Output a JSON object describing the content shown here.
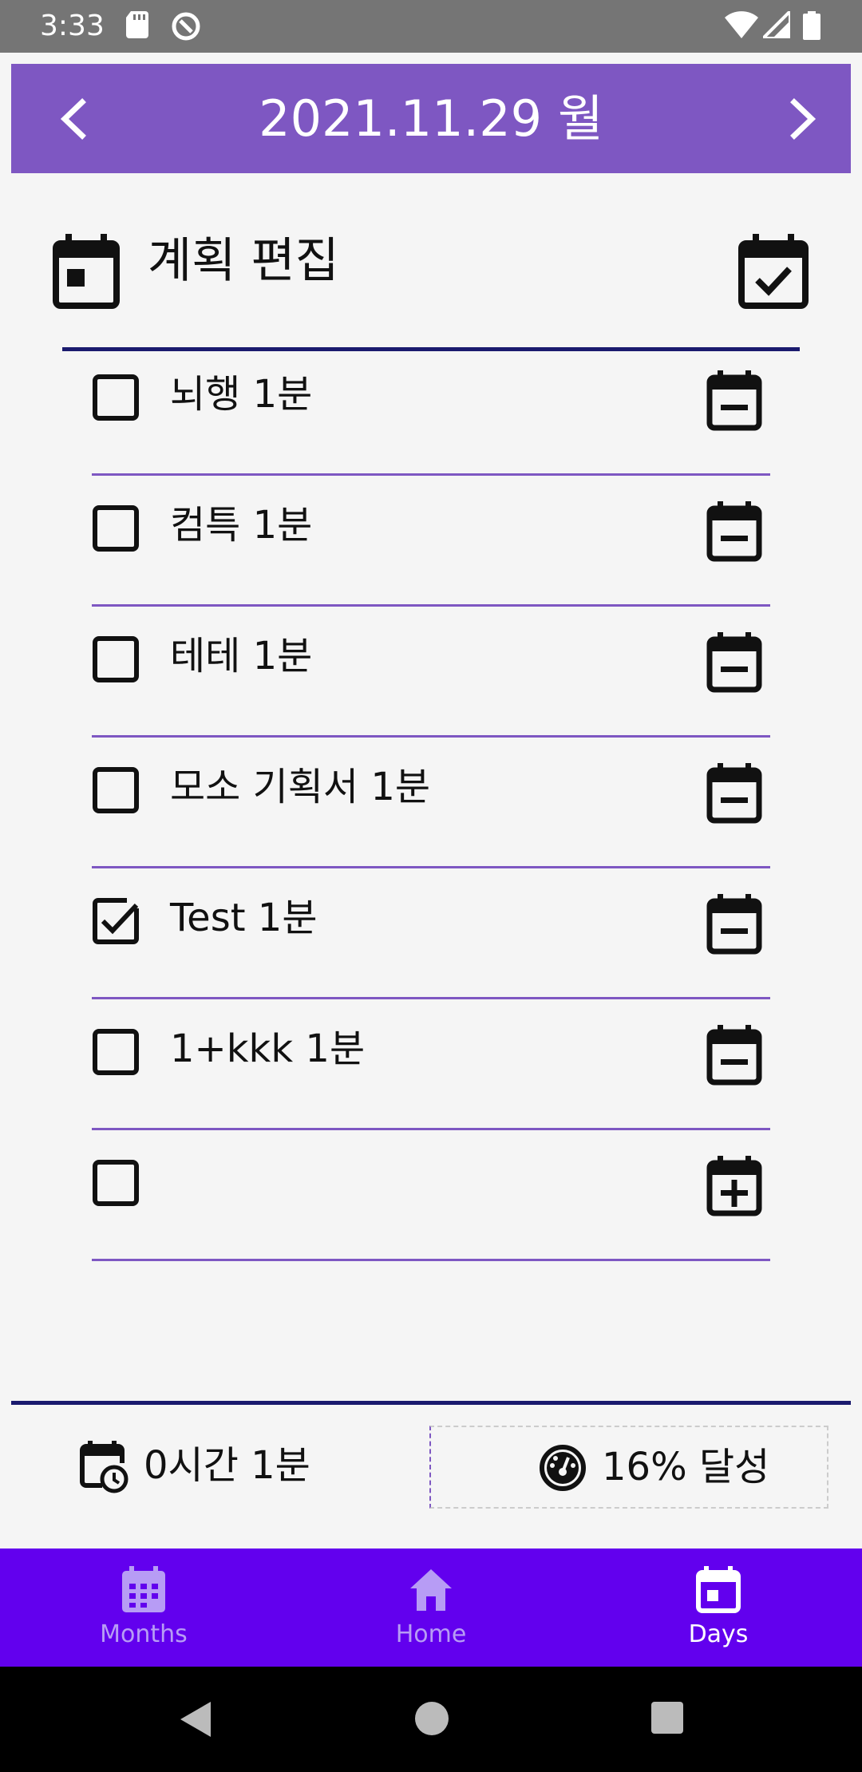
{
  "status_bar": {
    "time": "3:33"
  },
  "header": {
    "date": "2021.11.29 월"
  },
  "section": {
    "title": "계획 편집"
  },
  "tasks": [
    {
      "label": "뇌행 1분",
      "checked": false,
      "action_icon": "calendar-minus-icon"
    },
    {
      "label": "컴특 1분",
      "checked": false,
      "action_icon": "calendar-minus-icon"
    },
    {
      "label": "테테 1분",
      "checked": false,
      "action_icon": "calendar-minus-icon"
    },
    {
      "label": "모소 기획서 1분",
      "checked": false,
      "action_icon": "calendar-minus-icon"
    },
    {
      "label": "Test 1분",
      "checked": true,
      "action_icon": "calendar-minus-icon"
    },
    {
      "label": "1+kkk 1분",
      "checked": false,
      "action_icon": "calendar-minus-icon"
    },
    {
      "label": "",
      "checked": false,
      "action_icon": "calendar-plus-icon"
    }
  ],
  "stats": {
    "time_total": "0시간 1분",
    "achievement": "16% 달성"
  },
  "bottom_nav": {
    "items": [
      {
        "label": "Months",
        "icon": "calendar-month-icon",
        "active": false
      },
      {
        "label": "Home",
        "icon": "home-icon",
        "active": false
      },
      {
        "label": "Days",
        "icon": "calendar-day-icon",
        "active": true
      }
    ]
  },
  "colors": {
    "header_bg": "#7E57C2",
    "divider": "#7E57C2",
    "rule_dark": "#1A1A6E",
    "bottom_nav_bg": "#6200EE",
    "nav_inactive": "#B79CF5"
  }
}
